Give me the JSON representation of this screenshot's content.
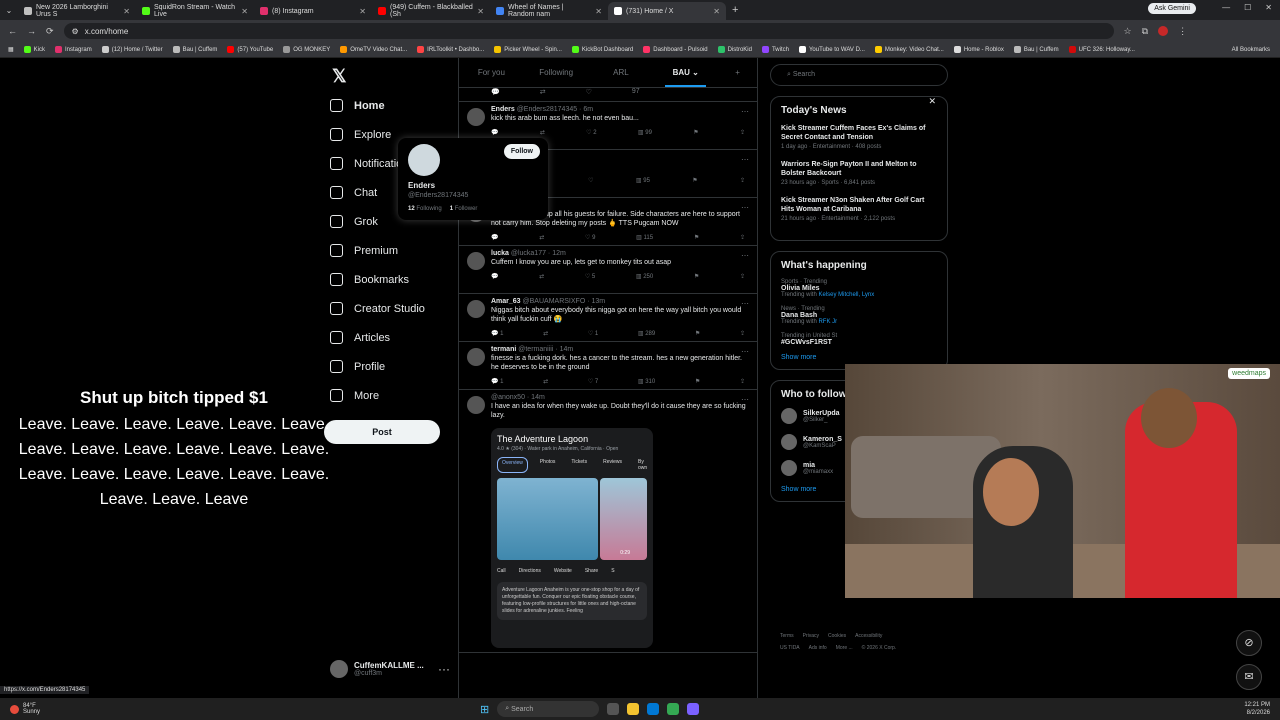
{
  "tabs": [
    {
      "title": "New 2026 Lamborghini Urus S",
      "color": "#c0c0c0"
    },
    {
      "title": "SquidRon Stream - Watch Live",
      "color": "#53fc18"
    },
    {
      "title": "(8) Instagram",
      "color": "#e1306c"
    },
    {
      "title": "(949) Cuffem - Blackballed (Sh",
      "color": "#ff0000"
    },
    {
      "title": "Wheel of Names | Random nam",
      "color": "#4285f4"
    },
    {
      "title": "(731) Home / X",
      "color": "#ffffff"
    }
  ],
  "gemini": "Ask Gemini",
  "url": "x.com/home",
  "bookmarks": [
    {
      "label": "Kick",
      "color": "#53fc18"
    },
    {
      "label": "Instagram",
      "color": "#e1306c"
    },
    {
      "label": "(12) Home / Twitter",
      "color": "#cccccc"
    },
    {
      "label": "Bau | Cuffem",
      "color": "#bbbbbb"
    },
    {
      "label": "(57) YouTube",
      "color": "#ff0000"
    },
    {
      "label": "OG MONKEY",
      "color": "#999999"
    },
    {
      "label": "OmeTV Video Chat...",
      "color": "#ff9900"
    },
    {
      "label": "IRLToolkit • Dashbo...",
      "color": "#ff4444"
    },
    {
      "label": "Picker Wheel - Spin...",
      "color": "#f5c400"
    },
    {
      "label": "KickBot Dashboard",
      "color": "#53fc18"
    },
    {
      "label": "Dashboard - Pulsoid",
      "color": "#ff3366"
    },
    {
      "label": "DistroKid",
      "color": "#2dc36a"
    },
    {
      "label": "Twitch",
      "color": "#9146ff"
    },
    {
      "label": "YouTube to WAV D...",
      "color": "#ffffff"
    },
    {
      "label": "Monkey: Video Chat...",
      "color": "#ffcc00"
    },
    {
      "label": "Home - Roblox",
      "color": "#dddddd"
    },
    {
      "label": "Bau | Cuffem",
      "color": "#bbbbbb"
    },
    {
      "label": "UFC 326: Holloway...",
      "color": "#d20a0a"
    }
  ],
  "all_bookmarks": "All Bookmarks",
  "nav": [
    "Home",
    "Explore",
    "Notifications",
    "Chat",
    "Grok",
    "Premium",
    "Bookmarks",
    "Creator Studio",
    "Articles",
    "Profile",
    "More"
  ],
  "post_label": "Post",
  "account": {
    "name": "CuffemKALLME ...",
    "handle": "@cuff3m"
  },
  "overlay": {
    "title": "Shut up bitch tipped $1",
    "body": "Leave. Leave. Leave. Leave. Leave. Leave. Leave. Leave. Leave. Leave. Leave. Leave. Leave. Leave. Leave. Leave. Leave. Leave. Leave. Leave. Leave"
  },
  "hovercard": {
    "follow": "Follow",
    "name": "Enders",
    "handle": "@Enders28174345",
    "following": "12",
    "following_label": "Following",
    "followers": "1",
    "followers_label": "Follower"
  },
  "feed_tabs": [
    "For you",
    "Following",
    "ARL",
    "BAU"
  ],
  "top_actions": {
    "likes": "97"
  },
  "tweets": [
    {
      "name": "Enders",
      "handle": "@Enders28174345 · 6m",
      "text": "kick this arab bum ass leech. he not even bau...",
      "replies": "",
      "rts": "",
      "likes": "2",
      "views": "99"
    },
    {
      "name": "",
      "handle": "serious · 6m",
      "text": "mer for?",
      "replies": "",
      "rts": "",
      "likes": "",
      "views": "95"
    },
    {
      "name": "",
      "handle": "7m",
      "text": "Cuffem is setting up all his guests for failure. Side characters are here to support not carry him. Stop deleting my posts 🖕 TTS Pugcam NOW",
      "replies": "",
      "rts": "",
      "likes": "9",
      "views": "115"
    },
    {
      "name": "lucka",
      "handle": "@lucka177 · 12m",
      "text": "Cuffem I know you are up, lets get to monkey tits out asap",
      "replies": "",
      "rts": "",
      "likes": "5",
      "views": "250"
    },
    {
      "name": "Amar_63",
      "handle": "@BAUAMARSIXFO · 13m",
      "text": "Niggas bitch about everybody this nigga got on here the way yall bitch you would think yall fuckin cuff 😭",
      "replies": "1",
      "rts": "",
      "likes": "1",
      "views": "289"
    },
    {
      "name": "termani",
      "handle": "@termaniiii · 14m",
      "text": "finesse is a fucking dork. hes a cancer to the stream. hes a new generation hitler. he deserves to be in the ground",
      "replies": "1",
      "rts": "",
      "likes": "7",
      "views": "310"
    },
    {
      "name": "",
      "handle": "@anonx50 · 14m",
      "text": "I have an idea for when they wake up. Doubt they'll do it cause they are so fucking lazy.",
      "replies": "",
      "rts": "",
      "likes": "",
      "views": ""
    }
  ],
  "card": {
    "title": "The Adventure Lagoon",
    "sub": "4.0 ★ (304) · Water park in Anaheim, California · Open",
    "tabs": [
      "Overview",
      "Photos",
      "Tickets",
      "Reviews",
      "By own"
    ],
    "duration": "0:29",
    "actions": [
      "Call",
      "Directions",
      "Website",
      "Share",
      "S"
    ],
    "desc": "Adventure Lagoon Anaheim is your one-stop shop for a day of unforgettable fun. Conquer our epic floating obstacle course, featuring low-profile structures for little ones and high-octane slides for adrenaline junkies. Feeling"
  },
  "search_placeholder": "Search",
  "todays_news": {
    "title": "Today's News",
    "items": [
      {
        "headline": "Kick Streamer Cuffem Faces Ex's Claims of Secret Contact and Tension",
        "meta": "1 day ago · Entertainment · 408 posts"
      },
      {
        "headline": "Warriors Re-Sign Payton II and Melton to Bolster Backcourt",
        "meta": "23 hours ago · Sports · 6,841 posts"
      },
      {
        "headline": "Kick Streamer N3on Shaken After Golf Cart Hits Woman at Caribana",
        "meta": "21 hours ago · Entertainment · 2,122 posts"
      }
    ]
  },
  "happening": {
    "title": "What's happening",
    "items": [
      {
        "context": "Sports · Trending",
        "name": "Olivia Miles",
        "with": "Trending with",
        "links": "Kelsey Mitchell, Lynx"
      },
      {
        "context": "News · Trending",
        "name": "Dana Bash",
        "with": "Trending with",
        "links": "RFK Jr"
      },
      {
        "context": "Trending in United St",
        "name": "#GCWvsF1RST",
        "with": "",
        "links": ""
      }
    ],
    "show_more": "Show more"
  },
  "who_to_follow": {
    "title": "Who to follow",
    "items": [
      {
        "name": "SilkerUpda",
        "handle": "@Silker_"
      },
      {
        "name": "Kameron_S",
        "handle": "@KamScaP"
      },
      {
        "name": "mia",
        "handle": "@miamaxx"
      }
    ],
    "show_more": "Show more"
  },
  "footer": [
    "Terms",
    "Privacy",
    "Cookies",
    "Accessibility",
    "US TIDA",
    "Ads info",
    "More ...",
    "© 2026 X Corp."
  ],
  "webcam_logo": "weedmaps",
  "status_url": "https://x.com/Enders28174345",
  "taskbar": {
    "temp": "84°F",
    "weather": "Sunny",
    "search": "Search",
    "time": "12:21 PM",
    "date": "8/2/2026"
  }
}
